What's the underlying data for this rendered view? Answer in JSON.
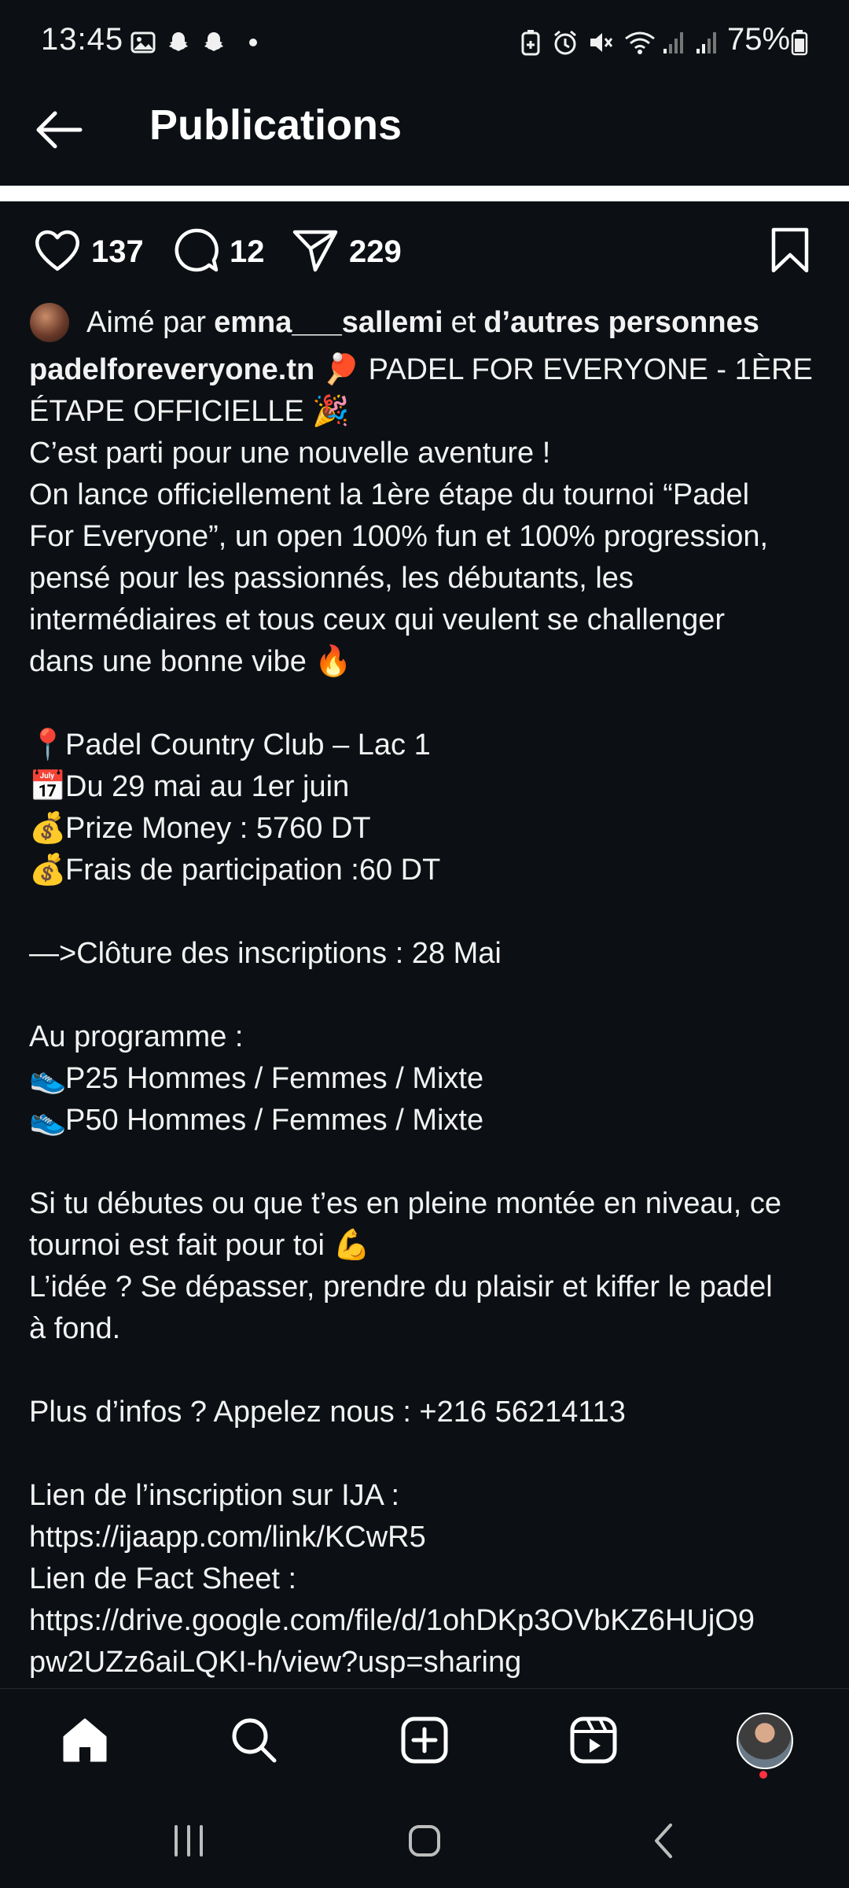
{
  "status_bar": {
    "time": "13:45",
    "battery": "75%",
    "left_icons": [
      "gallery-icon",
      "snapchat-icon",
      "snapchat-icon",
      "dot-icon"
    ],
    "right_icons": [
      "battery-saver-icon",
      "alarm-icon",
      "mute-icon",
      "wifi-icon",
      "signal-icon",
      "signal-icon",
      "battery-icon"
    ]
  },
  "header": {
    "back_icon": "back-arrow-icon",
    "title": "Publications"
  },
  "actions": {
    "likes": "137",
    "comments": "12",
    "shares": "229"
  },
  "likes_line": {
    "prefix": "Aimé par ",
    "user": "emna___sallemi",
    "middle": " et ",
    "others": "d’autres personnes"
  },
  "caption": {
    "username": "padelforeveryone.tn",
    "emoji_racket": "🏓",
    "title_part1": " PADEL FOR EVERYONE - 1ÈRE",
    "title_part2": "ÉTAPE OFFICIELLE",
    "emoji_party": "🎉",
    "l3": "C’est parti pour une nouvelle aventure !",
    "l4": "On lance officiellement la 1ère étape du tournoi “Padel",
    "l5": "For Everyone”, un open 100% fun et 100% progression,",
    "l6": "pensé pour les passionnés, les débutants, les",
    "l7": "intermédiaires et tous ceux qui veulent se challenger",
    "l8": "dans une bonne vibe",
    "emoji_fire": "🔥",
    "emoji_pin": "📍",
    "location": "Padel Country Club – Lac 1",
    "emoji_calendar": "📅",
    "dates": "Du 29 mai au 1er juin",
    "emoji_money": "💰",
    "prize": "Prize Money : 5760 DT",
    "fees": "Frais de participation :60 DT",
    "cloture": "—>Clôture des inscriptions : 28 Mai",
    "programme": "Au programme :",
    "emoji_shoe": "👟",
    "p25": "P25 Hommes / Femmes / Mixte",
    "p50": "P50 Hommes / Femmes / Mixte",
    "l_debutes1": "Si tu débutes ou que t’es en pleine montée en niveau, ce",
    "l_debutes2": "tournoi est fait pour toi",
    "emoji_muscle": "💪",
    "l_idee1": "L’idée ? Se dépasser, prendre du plaisir et kiffer le padel",
    "l_idee2": "à fond.",
    "infos": "Plus d’infos ? Appelez nous : +216 56214113",
    "ija_label": "Lien de l’inscription sur IJA :",
    "ija_link": "https://ijaapp.com/link/KCwR5",
    "fact_label": "Lien de Fact Sheet :",
    "fact_link1": "https://drive.google.com/file/d/1ohDKp3OVbKZ6HUjO9",
    "fact_link2": "pw2UZz6aiLQKI-h/view?usp=sharing"
  },
  "bottom_nav": [
    "home-icon",
    "search-icon",
    "create-icon",
    "reels-icon",
    "profile-avatar"
  ],
  "system_nav": [
    "recents-icon",
    "home-button-icon",
    "back-icon"
  ]
}
